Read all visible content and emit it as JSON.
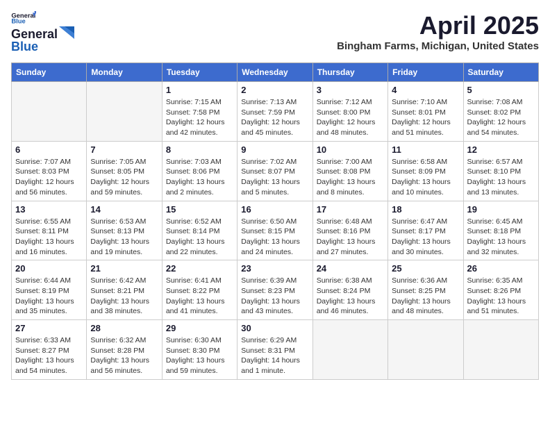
{
  "header": {
    "logo_line1": "General",
    "logo_line2": "Blue",
    "month": "April 2025",
    "location": "Bingham Farms, Michigan, United States"
  },
  "weekdays": [
    "Sunday",
    "Monday",
    "Tuesday",
    "Wednesday",
    "Thursday",
    "Friday",
    "Saturday"
  ],
  "weeks": [
    [
      {
        "day": "",
        "info": ""
      },
      {
        "day": "",
        "info": ""
      },
      {
        "day": "1",
        "info": "Sunrise: 7:15 AM\nSunset: 7:58 PM\nDaylight: 12 hours and 42 minutes."
      },
      {
        "day": "2",
        "info": "Sunrise: 7:13 AM\nSunset: 7:59 PM\nDaylight: 12 hours and 45 minutes."
      },
      {
        "day": "3",
        "info": "Sunrise: 7:12 AM\nSunset: 8:00 PM\nDaylight: 12 hours and 48 minutes."
      },
      {
        "day": "4",
        "info": "Sunrise: 7:10 AM\nSunset: 8:01 PM\nDaylight: 12 hours and 51 minutes."
      },
      {
        "day": "5",
        "info": "Sunrise: 7:08 AM\nSunset: 8:02 PM\nDaylight: 12 hours and 54 minutes."
      }
    ],
    [
      {
        "day": "6",
        "info": "Sunrise: 7:07 AM\nSunset: 8:03 PM\nDaylight: 12 hours and 56 minutes."
      },
      {
        "day": "7",
        "info": "Sunrise: 7:05 AM\nSunset: 8:05 PM\nDaylight: 12 hours and 59 minutes."
      },
      {
        "day": "8",
        "info": "Sunrise: 7:03 AM\nSunset: 8:06 PM\nDaylight: 13 hours and 2 minutes."
      },
      {
        "day": "9",
        "info": "Sunrise: 7:02 AM\nSunset: 8:07 PM\nDaylight: 13 hours and 5 minutes."
      },
      {
        "day": "10",
        "info": "Sunrise: 7:00 AM\nSunset: 8:08 PM\nDaylight: 13 hours and 8 minutes."
      },
      {
        "day": "11",
        "info": "Sunrise: 6:58 AM\nSunset: 8:09 PM\nDaylight: 13 hours and 10 minutes."
      },
      {
        "day": "12",
        "info": "Sunrise: 6:57 AM\nSunset: 8:10 PM\nDaylight: 13 hours and 13 minutes."
      }
    ],
    [
      {
        "day": "13",
        "info": "Sunrise: 6:55 AM\nSunset: 8:11 PM\nDaylight: 13 hours and 16 minutes."
      },
      {
        "day": "14",
        "info": "Sunrise: 6:53 AM\nSunset: 8:13 PM\nDaylight: 13 hours and 19 minutes."
      },
      {
        "day": "15",
        "info": "Sunrise: 6:52 AM\nSunset: 8:14 PM\nDaylight: 13 hours and 22 minutes."
      },
      {
        "day": "16",
        "info": "Sunrise: 6:50 AM\nSunset: 8:15 PM\nDaylight: 13 hours and 24 minutes."
      },
      {
        "day": "17",
        "info": "Sunrise: 6:48 AM\nSunset: 8:16 PM\nDaylight: 13 hours and 27 minutes."
      },
      {
        "day": "18",
        "info": "Sunrise: 6:47 AM\nSunset: 8:17 PM\nDaylight: 13 hours and 30 minutes."
      },
      {
        "day": "19",
        "info": "Sunrise: 6:45 AM\nSunset: 8:18 PM\nDaylight: 13 hours and 32 minutes."
      }
    ],
    [
      {
        "day": "20",
        "info": "Sunrise: 6:44 AM\nSunset: 8:19 PM\nDaylight: 13 hours and 35 minutes."
      },
      {
        "day": "21",
        "info": "Sunrise: 6:42 AM\nSunset: 8:21 PM\nDaylight: 13 hours and 38 minutes."
      },
      {
        "day": "22",
        "info": "Sunrise: 6:41 AM\nSunset: 8:22 PM\nDaylight: 13 hours and 41 minutes."
      },
      {
        "day": "23",
        "info": "Sunrise: 6:39 AM\nSunset: 8:23 PM\nDaylight: 13 hours and 43 minutes."
      },
      {
        "day": "24",
        "info": "Sunrise: 6:38 AM\nSunset: 8:24 PM\nDaylight: 13 hours and 46 minutes."
      },
      {
        "day": "25",
        "info": "Sunrise: 6:36 AM\nSunset: 8:25 PM\nDaylight: 13 hours and 48 minutes."
      },
      {
        "day": "26",
        "info": "Sunrise: 6:35 AM\nSunset: 8:26 PM\nDaylight: 13 hours and 51 minutes."
      }
    ],
    [
      {
        "day": "27",
        "info": "Sunrise: 6:33 AM\nSunset: 8:27 PM\nDaylight: 13 hours and 54 minutes."
      },
      {
        "day": "28",
        "info": "Sunrise: 6:32 AM\nSunset: 8:28 PM\nDaylight: 13 hours and 56 minutes."
      },
      {
        "day": "29",
        "info": "Sunrise: 6:30 AM\nSunset: 8:30 PM\nDaylight: 13 hours and 59 minutes."
      },
      {
        "day": "30",
        "info": "Sunrise: 6:29 AM\nSunset: 8:31 PM\nDaylight: 14 hours and 1 minute."
      },
      {
        "day": "",
        "info": ""
      },
      {
        "day": "",
        "info": ""
      },
      {
        "day": "",
        "info": ""
      }
    ]
  ]
}
